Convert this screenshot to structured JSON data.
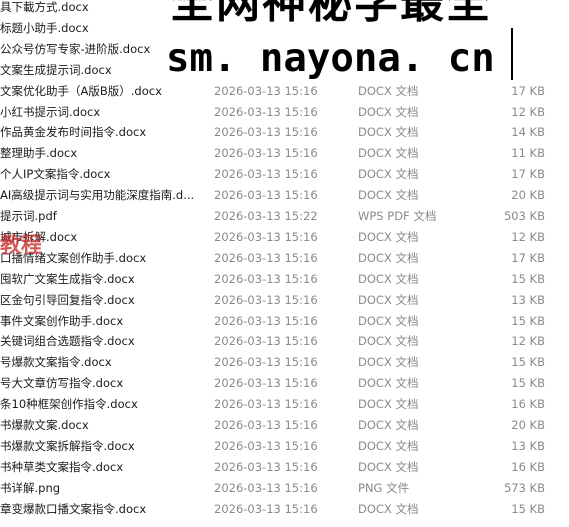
{
  "files": [
    {
      "name": "具下載方式.docx",
      "date": "",
      "type": "",
      "size": ""
    },
    {
      "name": "标题小助手.docx",
      "date": "",
      "type": "",
      "size": ""
    },
    {
      "name": "公众号仿写专家-进阶版.docx",
      "date": "",
      "type": "",
      "size": ""
    },
    {
      "name": "文案生成提示词.docx",
      "date": "",
      "type": "",
      "size": ""
    },
    {
      "name": "文案优化助手（A版B版）.docx",
      "date": "2026-03-13 15:16",
      "type": "DOCX 文档",
      "size": "17 KB"
    },
    {
      "name": "小红书提示词.docx",
      "date": "2026-03-13 15:16",
      "type": "DOCX 文档",
      "size": "12 KB"
    },
    {
      "name": "作品黄金发布时间指令.docx",
      "date": "2026-03-13 15:16",
      "type": "DOCX 文档",
      "size": "14 KB"
    },
    {
      "name": "整理助手.docx",
      "date": "2026-03-13 15:16",
      "type": "DOCX 文档",
      "size": "11 KB"
    },
    {
      "name": "个人IP文案指令.docx",
      "date": "2026-03-13 15:16",
      "type": "DOCX 文档",
      "size": "17 KB"
    },
    {
      "name": "AI高级提示词与实用功能深度指南.d...",
      "date": "2026-03-13 15:16",
      "type": "DOCX 文档",
      "size": "20 KB"
    },
    {
      "name": "提示词.pdf",
      "date": "2026-03-13 15:22",
      "type": "WPS PDF 文档",
      "size": "503 KB"
    },
    {
      "name": "城市拆解.docx",
      "date": "2026-03-13 15:16",
      "type": "DOCX 文档",
      "size": "12 KB"
    },
    {
      "name": "口播情绪文案创作助手.docx",
      "date": "2026-03-13 15:16",
      "type": "DOCX 文档",
      "size": "17 KB"
    },
    {
      "name": "囤软广文案生成指令.docx",
      "date": "2026-03-13 15:16",
      "type": "DOCX 文档",
      "size": "15 KB"
    },
    {
      "name": "区金句引导回复指令.docx",
      "date": "2026-03-13 15:16",
      "type": "DOCX 文档",
      "size": "13 KB"
    },
    {
      "name": "事件文案创作助手.docx",
      "date": "2026-03-13 15:16",
      "type": "DOCX 文档",
      "size": "15 KB"
    },
    {
      "name": "关键词组合选题指令.docx",
      "date": "2026-03-13 15:16",
      "type": "DOCX 文档",
      "size": "12 KB"
    },
    {
      "name": "号爆款文案指令.docx",
      "date": "2026-03-13 15:16",
      "type": "DOCX 文档",
      "size": "15 KB"
    },
    {
      "name": "号大文章仿写指令.docx",
      "date": "2026-03-13 15:16",
      "type": "DOCX 文档",
      "size": "15 KB"
    },
    {
      "name": "条10种框架创作指令.docx",
      "date": "2026-03-13 15:16",
      "type": "DOCX 文档",
      "size": "16 KB"
    },
    {
      "name": "书爆款文案.docx",
      "date": "2026-03-13 15:16",
      "type": "DOCX 文档",
      "size": "20 KB"
    },
    {
      "name": "书爆款文案拆解指令.docx",
      "date": "2026-03-13 15:16",
      "type": "DOCX 文档",
      "size": "13 KB"
    },
    {
      "name": "书种草类文案指令.docx",
      "date": "2026-03-13 15:16",
      "type": "DOCX 文档",
      "size": "16 KB"
    },
    {
      "name": "书详解.png",
      "date": "2026-03-13 15:16",
      "type": "PNG 文件",
      "size": "573 KB"
    },
    {
      "name": "章变爆款口播文案指令.docx",
      "date": "2026-03-13 15:16",
      "type": "DOCX 文档",
      "size": "15 KB"
    }
  ],
  "watermark": {
    "headline": "全网神秘学最全",
    "url": "sm. nayona. cn",
    "tag": "教程"
  }
}
